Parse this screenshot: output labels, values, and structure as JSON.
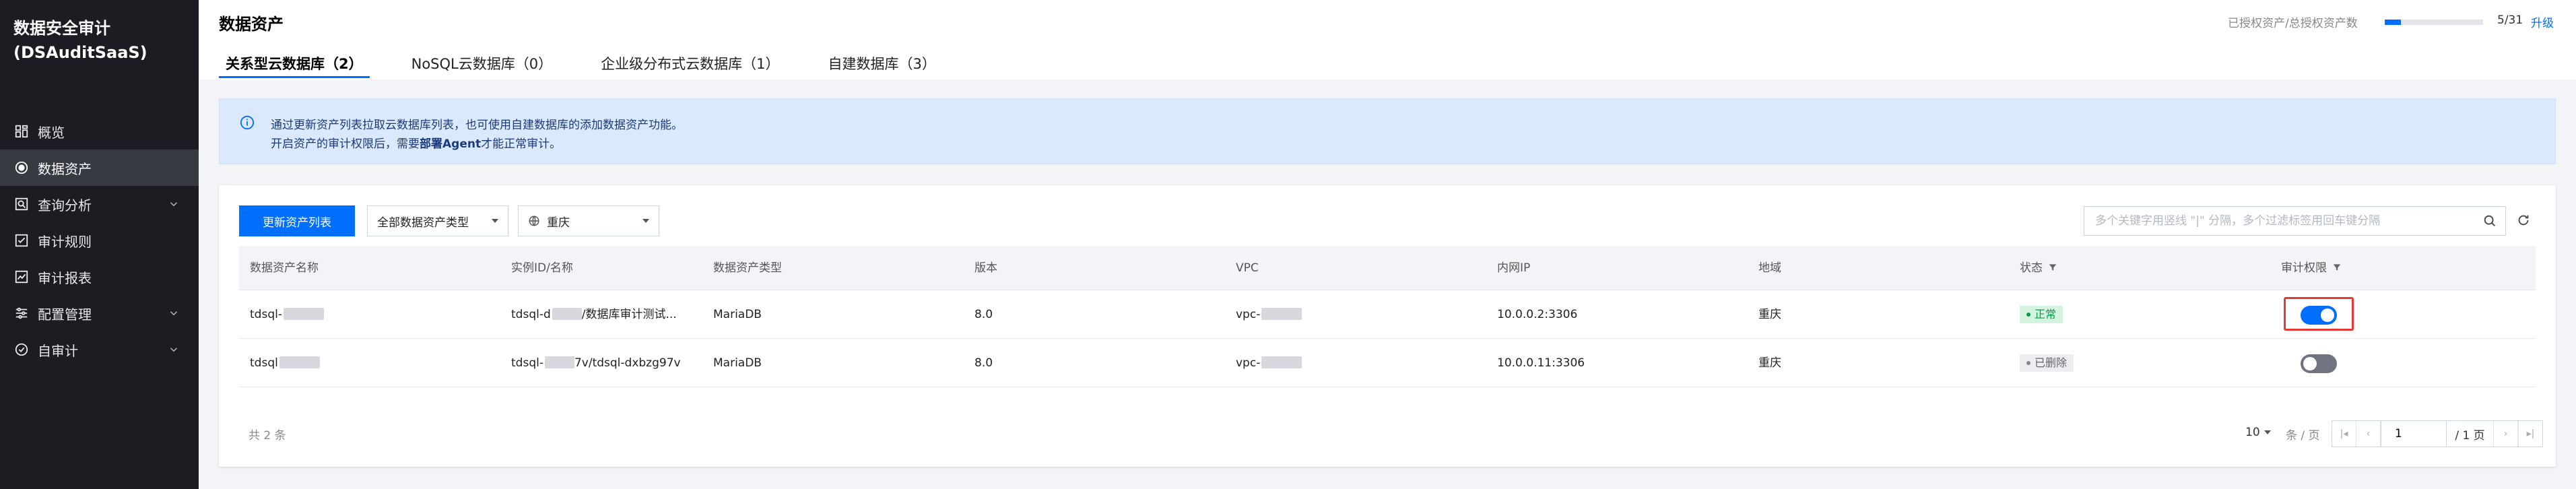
{
  "app": {
    "title_line1": "数据安全审计",
    "title_line2": "(DSAuditSaaS)"
  },
  "sidebar": {
    "items": [
      {
        "label": "概览",
        "icon": "dashboard-icon",
        "active": false,
        "expandable": false
      },
      {
        "label": "数据资产",
        "icon": "database-icon",
        "active": true,
        "expandable": false
      },
      {
        "label": "查询分析",
        "icon": "query-icon",
        "active": false,
        "expandable": true
      },
      {
        "label": "审计规则",
        "icon": "rule-icon",
        "active": false,
        "expandable": false
      },
      {
        "label": "审计报表",
        "icon": "report-icon",
        "active": false,
        "expandable": false
      },
      {
        "label": "配置管理",
        "icon": "config-icon",
        "active": false,
        "expandable": true
      },
      {
        "label": "自审计",
        "icon": "self-audit-icon",
        "active": false,
        "expandable": true
      }
    ]
  },
  "header": {
    "title": "数据资产",
    "quota": {
      "label": "已授权资产/总授权资产数",
      "count": "5/31",
      "fraction": 0.161,
      "upgrade": "升级"
    },
    "tabs": [
      {
        "label": "关系型云数据库（2）",
        "active": true
      },
      {
        "label": "NoSQL云数据库（0）",
        "active": false
      },
      {
        "label": "企业级分布式云数据库（1）",
        "active": false
      },
      {
        "label": "自建数据库（3）",
        "active": false
      }
    ]
  },
  "notice": {
    "line1": "通过更新资产列表拉取云数据库列表，也可使用自建数据库的添加数据资产功能。",
    "line2_pre": "开启资产的审计权限后，需要",
    "line2_bold": "部署Agent",
    "line2_post": "才能正常审计。"
  },
  "toolbar": {
    "update_button": "更新资产列表",
    "type_select": "全部数据资产类型",
    "region_select": "重庆",
    "search_placeholder": "多个关键字用竖线 \"|\" 分隔，多个过滤标签用回车键分隔"
  },
  "table": {
    "headers": [
      "数据资产名称",
      "实例ID/名称",
      "数据资产类型",
      "版本",
      "VPC",
      "内网IP",
      "地域",
      "状态",
      "审计权限"
    ],
    "rows": [
      {
        "name": "tdsql-",
        "instance_pre": "tdsql-d",
        "instance_post": "/数据库审计测试...",
        "type": "MariaDB",
        "version": "8.0",
        "vpc": "vpc-",
        "ip": "10.0.0.2:3306",
        "region": "重庆",
        "status": "正常",
        "status_kind": "ok",
        "audit": true
      },
      {
        "name": "tdsql",
        "instance_pre": "tdsql-",
        "instance_post": "7v/tdsql-dxbzg97v",
        "type": "MariaDB",
        "version": "8.0",
        "vpc": "vpc-",
        "ip": "10.0.0.11:3306",
        "region": "重庆",
        "status": "已删除",
        "status_kind": "del",
        "audit": false
      }
    ]
  },
  "footer": {
    "total": "共 2 条",
    "page_size": "10",
    "per_page": "条 / 页",
    "current_page": "1",
    "total_pages": "/ 1 页"
  },
  "colors": {
    "accent": "#006eff",
    "sidebar_bg": "#1c1d22",
    "sidebar_active": "#383a43",
    "notice_bg": "#dbe9ff",
    "ok_green": "#0a9b4a",
    "highlight_red": "#e53935"
  }
}
